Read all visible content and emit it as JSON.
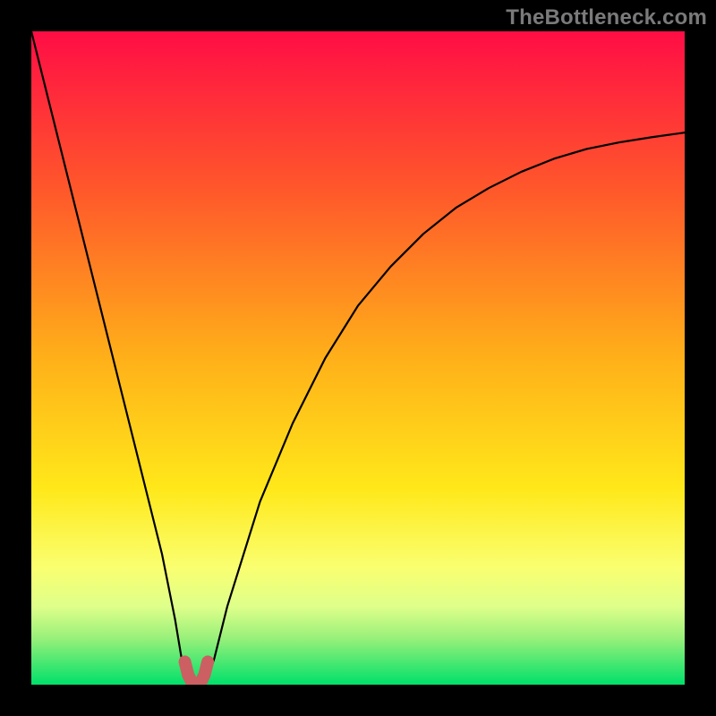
{
  "watermark": "TheBottleneck.com",
  "chart_data": {
    "type": "line",
    "title": "",
    "xlabel": "",
    "ylabel": "",
    "xlim": [
      0,
      100
    ],
    "ylim": [
      0,
      100
    ],
    "grid": false,
    "series": [
      {
        "name": "bottleneck-curve",
        "x": [
          0,
          5,
          10,
          15,
          18,
          20,
          22,
          23,
          24,
          25,
          26,
          27,
          28,
          30,
          35,
          40,
          45,
          50,
          55,
          60,
          65,
          70,
          75,
          80,
          85,
          90,
          95,
          100
        ],
        "values": [
          100,
          80,
          60,
          40,
          28,
          20,
          10,
          4,
          1,
          0,
          0,
          1,
          4,
          12,
          28,
          40,
          50,
          58,
          64,
          69,
          73,
          76,
          78.5,
          80.5,
          82,
          83,
          83.8,
          84.5
        ]
      },
      {
        "name": "sweet-spot-marker",
        "x": [
          23.5,
          24,
          24.5,
          25,
          25.5,
          26,
          26.5,
          27
        ],
        "values": [
          3.5,
          1.5,
          0.5,
          0,
          0,
          0.5,
          1.5,
          3.5
        ]
      }
    ],
    "background_gradient": {
      "type": "vertical",
      "stops": [
        {
          "pos": 0.0,
          "color": "#ff0d45"
        },
        {
          "pos": 0.25,
          "color": "#ff5a2a"
        },
        {
          "pos": 0.5,
          "color": "#ffb019"
        },
        {
          "pos": 0.7,
          "color": "#ffe81a"
        },
        {
          "pos": 0.82,
          "color": "#faff70"
        },
        {
          "pos": 0.88,
          "color": "#dfff8a"
        },
        {
          "pos": 0.93,
          "color": "#96f07a"
        },
        {
          "pos": 1.0,
          "color": "#00e06a"
        }
      ]
    },
    "colors": {
      "curve": "#000000",
      "marker": "#cc5f62",
      "frame": "#000000"
    }
  }
}
